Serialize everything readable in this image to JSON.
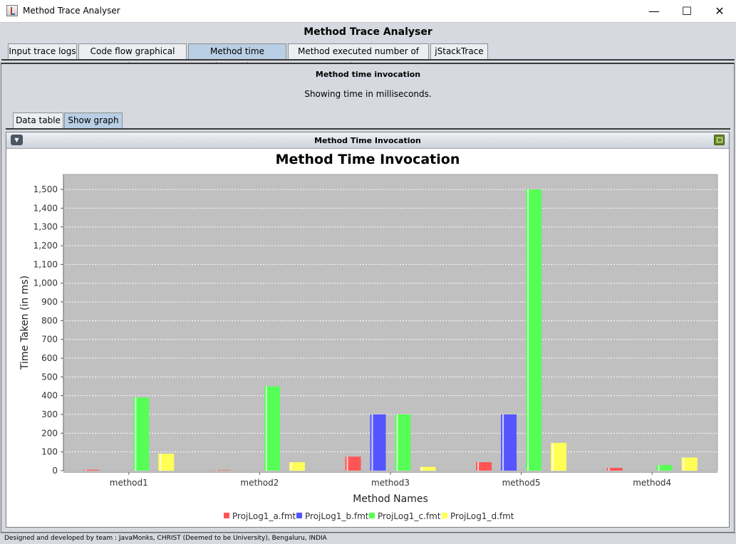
{
  "window": {
    "title": "Method Trace Analyser",
    "min": "—",
    "max": "☐",
    "close": "✕"
  },
  "app": {
    "heading": "Method Trace Analyser"
  },
  "tabs": [
    "Input trace logs",
    "Code flow graphical view",
    "Method time invocation",
    "Method executed number of times",
    "jStackTrace"
  ],
  "active_tab": 2,
  "panel": {
    "title": "Method time invocation",
    "subtitle": "Showing time in milliseconds."
  },
  "subtabs": [
    "Data table",
    "Show graph"
  ],
  "active_subtab": 1,
  "frame": {
    "title": "Method Time Invocation"
  },
  "chart_data": {
    "type": "bar",
    "title": "Method Time Invocation",
    "xlabel": "Method Names",
    "ylabel": "Time Taken (in ms)",
    "ylim": [
      0,
      1580
    ],
    "ticks": [
      0,
      100,
      200,
      300,
      400,
      500,
      600,
      700,
      800,
      900,
      1000,
      1100,
      1200,
      1300,
      1400,
      1500
    ],
    "tick_labels": [
      "0",
      "100",
      "200",
      "300",
      "400",
      "500",
      "600",
      "700",
      "800",
      "900",
      "1,000",
      "1,100",
      "1,200",
      "1,300",
      "1,400",
      "1,500"
    ],
    "grid": true,
    "legend_position": "bottom",
    "categories": [
      "method1",
      "method2",
      "method3",
      "method5",
      "method4"
    ],
    "series": [
      {
        "name": "ProjLog1_a.fmt",
        "color": "#ff5555",
        "values": [
          5,
          3,
          75,
          45,
          15
        ]
      },
      {
        "name": "ProjLog1_b.fmt",
        "color": "#5555ff",
        "values": [
          0,
          0,
          300,
          300,
          0
        ]
      },
      {
        "name": "ProjLog1_c.fmt",
        "color": "#55ff55",
        "values": [
          390,
          450,
          300,
          1500,
          30
        ]
      },
      {
        "name": "ProjLog1_d.fmt",
        "color": "#ffff55",
        "values": [
          90,
          45,
          20,
          148,
          70
        ]
      }
    ]
  },
  "status": "Designed and developed by team : JavaMonks, CHRIST (Deemed to be University), Bengaluru, INDIA"
}
